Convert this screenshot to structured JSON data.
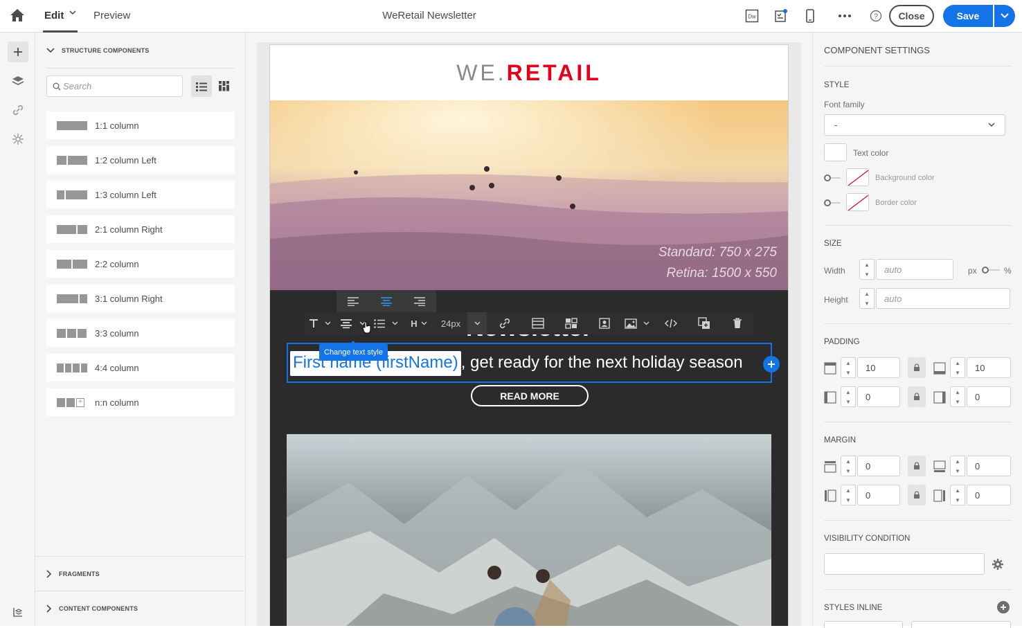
{
  "header": {
    "tab_edit": "Edit",
    "tab_preview": "Preview",
    "title": "WeRetail Newsletter",
    "dw_icon_label": "Dw",
    "close_label": "Close",
    "save_label": "Save"
  },
  "left_panel": {
    "structure_title": "STRUCTURE COMPONENTS",
    "search_placeholder": "Search",
    "components": [
      {
        "label": "1:1 column"
      },
      {
        "label": "1:2 column Left"
      },
      {
        "label": "1:3 column Left"
      },
      {
        "label": "2:1 column Right"
      },
      {
        "label": "2:2 column"
      },
      {
        "label": "3:1 column Right"
      },
      {
        "label": "3:3 column"
      },
      {
        "label": "4:4 column"
      },
      {
        "label": "n:n column"
      }
    ],
    "fragments_title": "FRAGMENTS",
    "content_title": "CONTENT COMPONENTS"
  },
  "email": {
    "logo_part1": "WE.",
    "logo_part2": "RETAIL",
    "hero_caption_1": "Standard: 750 x 275",
    "hero_caption_2": "Retina: 1500 x 550",
    "newsletter_heading": "Newsletter",
    "personalization": "First name (firstName)",
    "headline_rest": ", get ready for the next holiday season",
    "read_more": "READ MORE"
  },
  "editor_toolbar": {
    "font_size": "24px",
    "heading_label": "H",
    "tooltip": "Change text style"
  },
  "right_panel": {
    "title": "COMPONENT SETTINGS",
    "style_title": "STYLE",
    "font_family_label": "Font family",
    "font_family_value": "-",
    "text_color_label": "Text color",
    "bg_color_label": "Background color",
    "border_color_label": "Border color",
    "size_title": "SIZE",
    "width_label": "Width",
    "width_placeholder": "auto",
    "unit_px": "px",
    "unit_pct": "%",
    "height_label": "Height",
    "height_placeholder": "auto",
    "padding_title": "PADDING",
    "padding_top": "10",
    "padding_bottom": "10",
    "padding_left": "0",
    "padding_right": "0",
    "margin_title": "MARGIN",
    "margin_top": "0",
    "margin_bottom": "0",
    "margin_left": "0",
    "margin_right": "0",
    "visibility_title": "VISIBILITY CONDITION",
    "styles_inline_title": "STYLES INLINE"
  },
  "colors": {
    "accent": "#1473e6",
    "brand_red": "#e3001b",
    "panel_bg": "#f5f5f5",
    "email_dark": "#2b2b2b"
  }
}
